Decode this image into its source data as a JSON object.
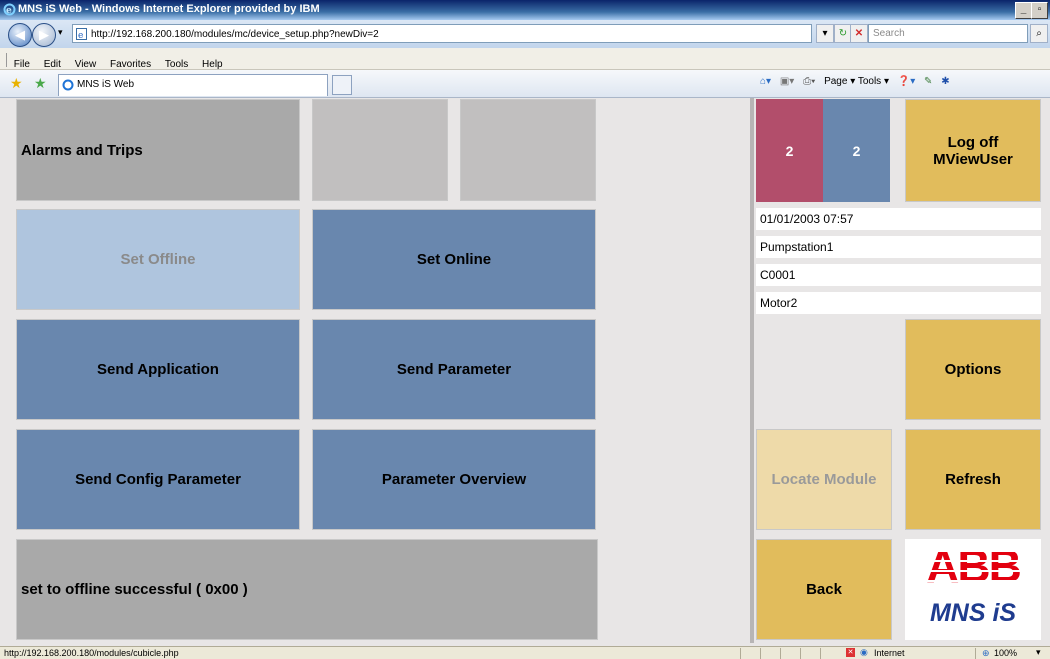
{
  "window": {
    "title": "MNS iS Web - Windows Internet Explorer provided by IBM",
    "url": "http://192.168.200.180/modules/mc/device_setup.php?newDiv=2",
    "search_placeholder": "Search",
    "menu": [
      "File",
      "Edit",
      "View",
      "Favorites",
      "Tools",
      "Help"
    ],
    "tab_title": "MNS iS Web",
    "command_bar": "Page ▾  Tools ▾",
    "status_url": "http://192.168.200.180/modules/cubicle.php",
    "status_zone": "Internet",
    "zoom": "100%"
  },
  "main": {
    "alarms_label": "Alarms and Trips",
    "set_offline_label": "Set Offline",
    "set_online_label": "Set Online",
    "send_application_label": "Send Application",
    "send_parameter_label": "Send Parameter",
    "send_config_parameter_label": "Send Config Parameter",
    "parameter_overview_label": "Parameter Overview",
    "status_message": "set to offline successful ( 0x00 )"
  },
  "side": {
    "counter_a": "2",
    "counter_b": "2",
    "logoff_line1": "Log off",
    "logoff_line2": "MViewUser",
    "datetime": "01/01/2003 07:57",
    "station": "Pumpstation1",
    "cubicle": "C0001",
    "device": "Motor2",
    "options_label": "Options",
    "locate_module_label": "Locate Module",
    "refresh_label": "Refresh",
    "back_label": "Back",
    "logo_brand": "ABB",
    "logo_product": "MNS iS"
  },
  "colors": {
    "counter_a": "#b24e6b",
    "counter_b": "#6987ae",
    "gold": "#e1bc5c",
    "abb_red": "#e3000f",
    "mns_blue": "#1f3c8f"
  }
}
